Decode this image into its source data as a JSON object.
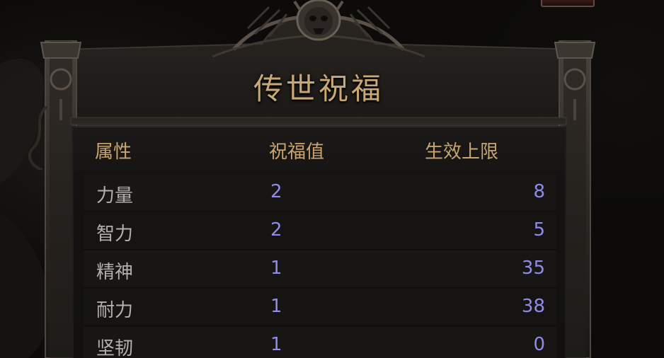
{
  "window": {
    "title": "传世祝福"
  },
  "table": {
    "headers": {
      "attribute": "属性",
      "blessing_value": "祝福值",
      "effective_cap": "生效上限"
    },
    "rows": [
      {
        "attribute": "力量",
        "blessing_value": "2",
        "effective_cap": "8"
      },
      {
        "attribute": "智力",
        "blessing_value": "2",
        "effective_cap": "5"
      },
      {
        "attribute": "精神",
        "blessing_value": "1",
        "effective_cap": "35"
      },
      {
        "attribute": "耐力",
        "blessing_value": "1",
        "effective_cap": "38"
      },
      {
        "attribute": "坚韧",
        "blessing_value": "1",
        "effective_cap": "0"
      }
    ]
  },
  "colors": {
    "title": "#c9a877",
    "header_text": "#c8a471",
    "attribute_text": "#b3b0ac",
    "value_text": "#8f8be6",
    "panel_background": "#141312"
  },
  "icons": {
    "crest": "demon-skull-crest-icon",
    "corner_ornament": "filigree-ornament-icon"
  }
}
